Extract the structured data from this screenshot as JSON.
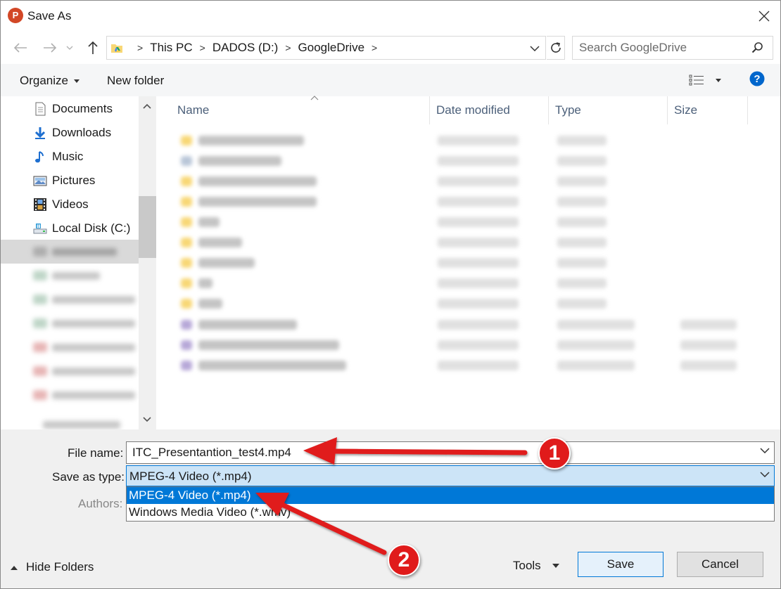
{
  "window": {
    "title": "Save As",
    "app_icon_letter": "P"
  },
  "address": {
    "crumbs": [
      "This PC",
      "DADOS (D:)",
      "GoogleDrive"
    ],
    "search_placeholder": "Search GoogleDrive"
  },
  "toolbar": {
    "organize": "Organize",
    "new_folder": "New folder",
    "help": "?"
  },
  "nav": {
    "items": [
      {
        "label": "Documents",
        "icon": "documents-icon"
      },
      {
        "label": "Downloads",
        "icon": "downloads-icon"
      },
      {
        "label": "Music",
        "icon": "music-icon"
      },
      {
        "label": "Pictures",
        "icon": "pictures-icon"
      },
      {
        "label": "Videos",
        "icon": "videos-icon"
      },
      {
        "label": "Local Disk (C:)",
        "icon": "local-disk-icon"
      }
    ]
  },
  "columns": {
    "name": "Name",
    "date": "Date modified",
    "type": "Type",
    "size": "Size"
  },
  "form": {
    "file_name_label": "File name:",
    "file_name_value": "ITC_Presentantion_test4.mp4",
    "save_type_label": "Save as type:",
    "save_type_value": "MPEG-4 Video (*.mp4)",
    "authors_label": "Authors:",
    "type_options": [
      "MPEG-4 Video (*.mp4)",
      "Windows Media Video (*.wmv)"
    ]
  },
  "footer": {
    "hide_folders": "Hide Folders",
    "tools": "Tools",
    "save": "Save",
    "cancel": "Cancel"
  },
  "annotations": {
    "badge_1": "1",
    "badge_2": "2"
  },
  "colors": {
    "accent": "#0078d7",
    "selection": "#cce4f7",
    "annotation_red": "#e01b1b",
    "folder_yellow": "#f8d775"
  }
}
